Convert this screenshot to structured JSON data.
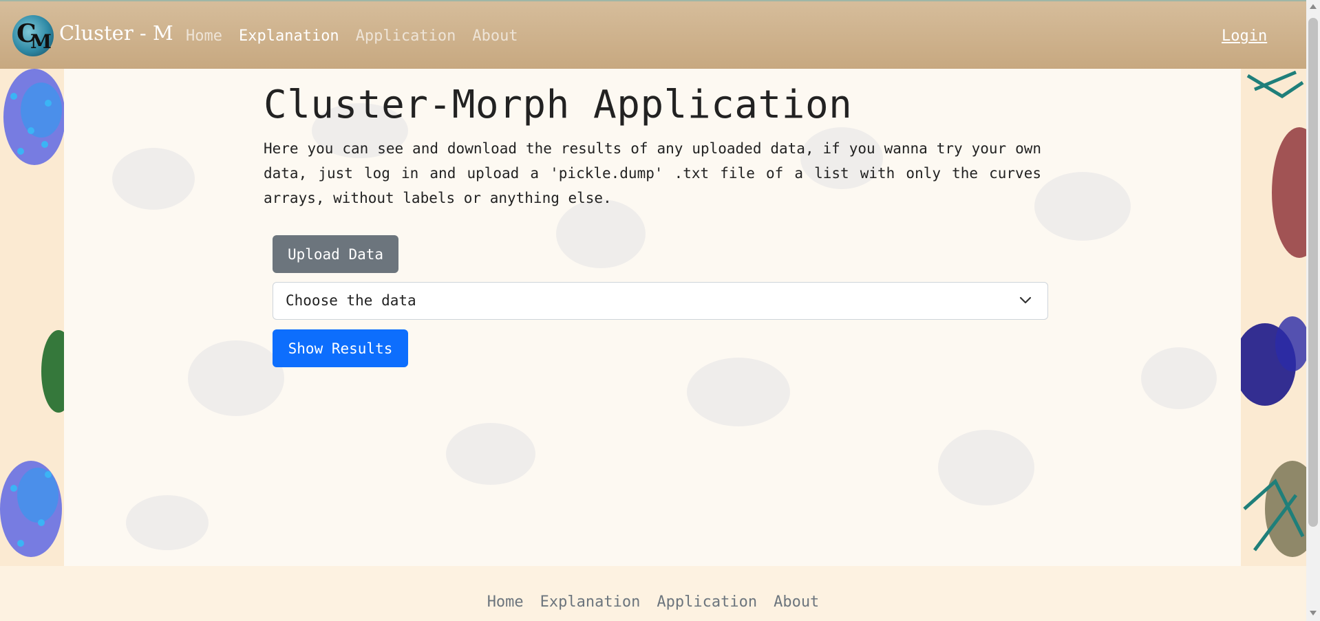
{
  "brand": {
    "logo_c": "C",
    "logo_m": "M",
    "name": "Cluster - M"
  },
  "nav": {
    "items": [
      {
        "label": "Home",
        "active": false
      },
      {
        "label": "Explanation",
        "active": true
      },
      {
        "label": "Application",
        "active": false
      },
      {
        "label": "About",
        "active": false
      }
    ],
    "login": "Login"
  },
  "main": {
    "title": "Cluster-Morph Application",
    "description": "Here you can see and download the results of any uploaded data, if you wanna try your own data, just log in and upload a 'pickle.dump' .txt file of a list with only the curves arrays, without labels or anything else.",
    "upload_label": "Upload Data",
    "select_placeholder": "Choose the data",
    "show_label": "Show Results"
  },
  "footer": {
    "items": [
      "Home",
      "Explanation",
      "Application",
      "About"
    ]
  },
  "colors": {
    "navbar": "#c7a880",
    "upload_button": "#6c757d",
    "show_button": "#0d6efd",
    "page_bg": "#fbf0dd"
  }
}
